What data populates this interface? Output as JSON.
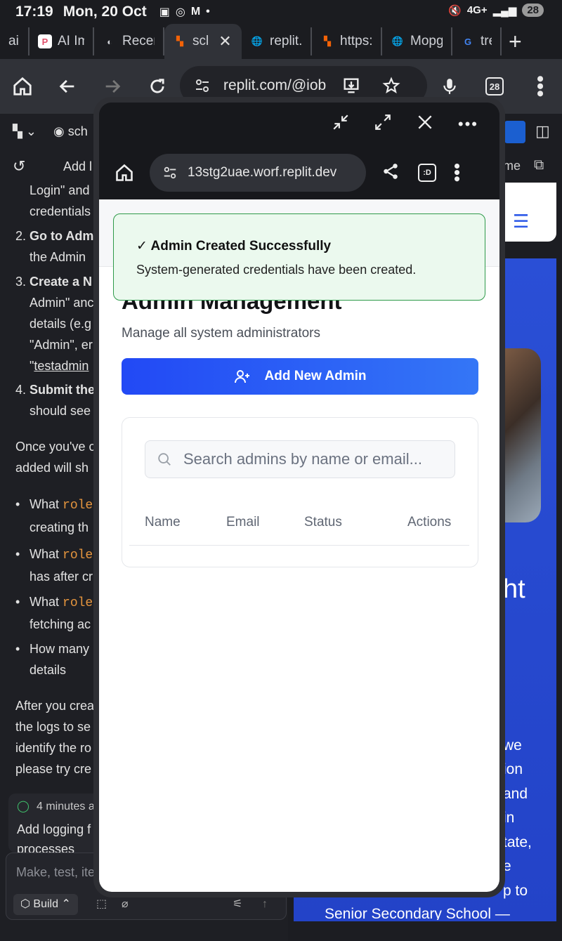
{
  "status_bar": {
    "time": "17:19",
    "date": "Mon, 20 Oct",
    "signal": "4G+",
    "battery": "28"
  },
  "tabs": [
    {
      "label": "ail",
      "favicon_color": "#555"
    },
    {
      "label": "AI Ima",
      "favicon": "P",
      "favicon_color": "#e04f6a"
    },
    {
      "label": "Recen",
      "favicon": "◐",
      "favicon_color": "#cfd1d6"
    },
    {
      "label": "scl",
      "favicon": "▚",
      "favicon_color": "#f26207",
      "active": true
    },
    {
      "label": "replit.",
      "favicon": "🌐",
      "favicon_color": "#cfd1d6"
    },
    {
      "label": "https:",
      "favicon": "▚",
      "favicon_color": "#f26207"
    },
    {
      "label": "Mopg",
      "favicon": "🌐",
      "favicon_color": "#cfd1d6"
    },
    {
      "label": "trea",
      "favicon": "G",
      "favicon_color": "#4285f4"
    }
  ],
  "toolbar": {
    "url": "replit.com/@iob",
    "tab_count": "28"
  },
  "background": {
    "project_label": "sch",
    "add_label": "Add l",
    "open_label": "me",
    "lines": [
      "Login\" and",
      "credentials",
      "Go to Adm",
      "the Admin",
      "Create a N",
      "Admin\" anc",
      "details (e.g",
      "\"Admin\", er",
      "testadmin",
      "Submit the",
      "should see",
      "Once you've c",
      "added will sh",
      "What",
      "role",
      "creating th",
      "What",
      "role",
      "has after cr",
      "What",
      "role",
      "fetching ac",
      "How many",
      "details",
      "After you crea",
      "the logs to se",
      "identify the ro",
      "please try cre",
      "4 minutes a",
      "Add logging f",
      "processes",
      "Make, test, ite",
      "Build"
    ],
    "right_lines": [
      "ht",
      "we",
      "ion",
      "and",
      "in",
      "tate,",
      "e",
      "p to",
      "Senior Secondary School —"
    ]
  },
  "popup": {
    "url": "13stg2uae.worf.replit.dev",
    "toast_title": "✓ Admin Created Successfully",
    "toast_message": "System-generated credentials have been created.",
    "page_title": "Admin Management",
    "page_subtitle": "Manage all system administrators",
    "add_button": "Add New Admin",
    "search_placeholder": "Search admins by name or email...",
    "columns": [
      "Name",
      "Email",
      "Status",
      "Actions"
    ]
  }
}
